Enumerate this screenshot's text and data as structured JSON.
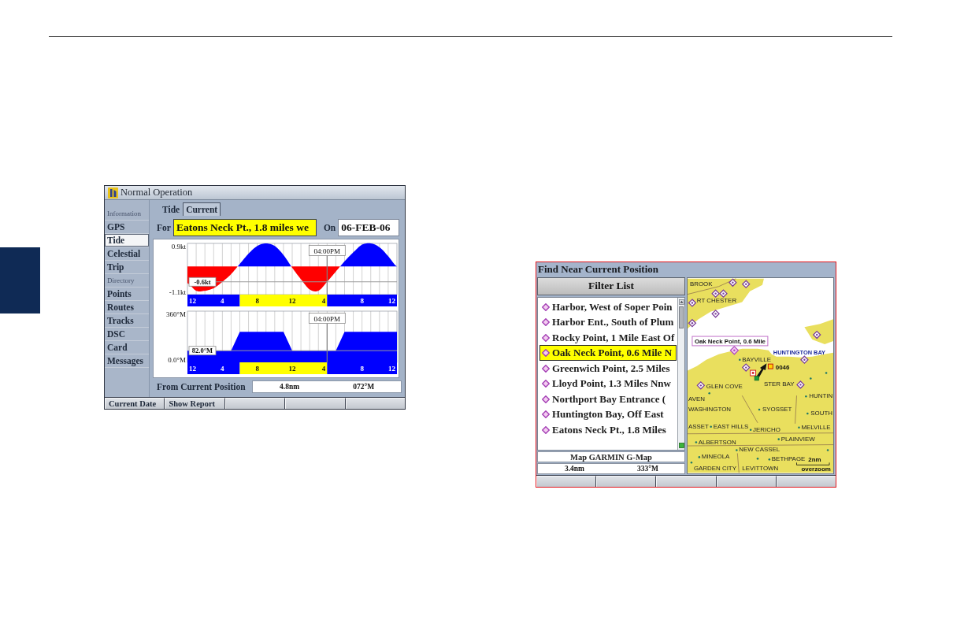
{
  "tide_screen": {
    "title": "Normal Operation",
    "menu": [
      {
        "kind": "header",
        "label": "Information"
      },
      {
        "kind": "item",
        "label": "GPS",
        "selected": false
      },
      {
        "kind": "item",
        "label": "Tide",
        "selected": true
      },
      {
        "kind": "item",
        "label": "Celestial",
        "selected": false
      },
      {
        "kind": "item",
        "label": "Trip",
        "selected": false
      },
      {
        "kind": "header",
        "label": "Directory"
      },
      {
        "kind": "item",
        "label": "Points",
        "selected": false
      },
      {
        "kind": "item",
        "label": "Routes",
        "selected": false
      },
      {
        "kind": "item",
        "label": "Tracks",
        "selected": false
      },
      {
        "kind": "item",
        "label": "DSC",
        "selected": false
      },
      {
        "kind": "item",
        "label": "Card",
        "selected": false
      },
      {
        "kind": "item",
        "label": "Messages",
        "selected": false
      }
    ],
    "tabs": [
      {
        "label": "Tide",
        "selected": false
      },
      {
        "label": "Current",
        "selected": true
      }
    ],
    "station": {
      "label": "For",
      "value": "Eatons Neck Pt., 1.8 miles we"
    },
    "date": {
      "label": "On",
      "value": "06-FEB-06"
    },
    "speed_graph": {
      "y_labels": [
        "0.9kt",
        "-1.1kt"
      ],
      "hour_labels": [
        "12",
        "4",
        "8",
        "12",
        "4",
        "8",
        "12"
      ],
      "cursor_time": "04:00PM",
      "reading": "-0.6kt"
    },
    "direction_graph": {
      "y_labels": [
        "360°M",
        "0.0°M"
      ],
      "hour_labels": [
        "12",
        "4",
        "8",
        "12",
        "4",
        "8",
        "12"
      ],
      "cursor_time": "04:00PM",
      "reading": "82.0°M"
    },
    "position": {
      "label": "From Current Position",
      "distance": "4.8nm",
      "bearing": "072°M"
    },
    "softkeys": [
      "Current Date",
      "Show Report"
    ]
  },
  "find_screen": {
    "title": "Find Near Current Position",
    "filter_button": "Filter List",
    "results": [
      {
        "label": "Harbor, West of Soper Poin",
        "selected": false
      },
      {
        "label": "Harbor Ent., South of Plum",
        "selected": false
      },
      {
        "label": "Rocky Point, 1 Mile East Of",
        "selected": false
      },
      {
        "label": "Oak Neck Point, 0.6 Mile N",
        "selected": true
      },
      {
        "label": "Greenwich Point, 2.5 Miles",
        "selected": false
      },
      {
        "label": "Lloyd Point, 1.3 Miles Nnw",
        "selected": false
      },
      {
        "label": "Northport Bay Entrance (",
        "selected": false
      },
      {
        "label": "Huntington Bay, Off East",
        "selected": false
      },
      {
        "label": "Eatons Neck Pt., 1.8 Miles",
        "selected": false
      }
    ],
    "map_source": "Map GARMIN G-Map",
    "distance": "3.4nm",
    "bearing": "333°M",
    "map": {
      "labels": [
        {
          "kind": "town",
          "text": "BROOK"
        },
        {
          "kind": "town",
          "text": "RT CHESTER"
        },
        {
          "kind": "water",
          "text": "HUNTINGTON BAY"
        },
        {
          "kind": "town",
          "text": "BAYVILLE"
        },
        {
          "kind": "vessel",
          "text": "0046"
        },
        {
          "kind": "town",
          "text": "STER BAY"
        },
        {
          "kind": "town",
          "text": "GLEN COVE"
        },
        {
          "kind": "town",
          "text": "HUNTIN"
        },
        {
          "kind": "town",
          "text": "AVEN"
        },
        {
          "kind": "town",
          "text": "WASHINGTON"
        },
        {
          "kind": "town",
          "text": "SYOSSET"
        },
        {
          "kind": "town",
          "text": "SOUTH"
        },
        {
          "kind": "town",
          "text": "ASSET"
        },
        {
          "kind": "town",
          "text": "EAST HILLS"
        },
        {
          "kind": "town",
          "text": "JERICHO"
        },
        {
          "kind": "town",
          "text": "MELVILLE"
        },
        {
          "kind": "town",
          "text": "PLAINVIEW"
        },
        {
          "kind": "town",
          "text": "ALBERTSON"
        },
        {
          "kind": "town",
          "text": "NEW CASSEL"
        },
        {
          "kind": "town",
          "text": "MINEOLA"
        },
        {
          "kind": "town",
          "text": "BETHPAGE"
        },
        {
          "kind": "town",
          "text": "GARDEN CITY"
        },
        {
          "kind": "town",
          "text": "LEVITTOWN"
        }
      ],
      "callout": "Oak Neck Point, 0.6 Mile",
      "scale": "2nm",
      "zoom_note": "overzoom"
    }
  }
}
